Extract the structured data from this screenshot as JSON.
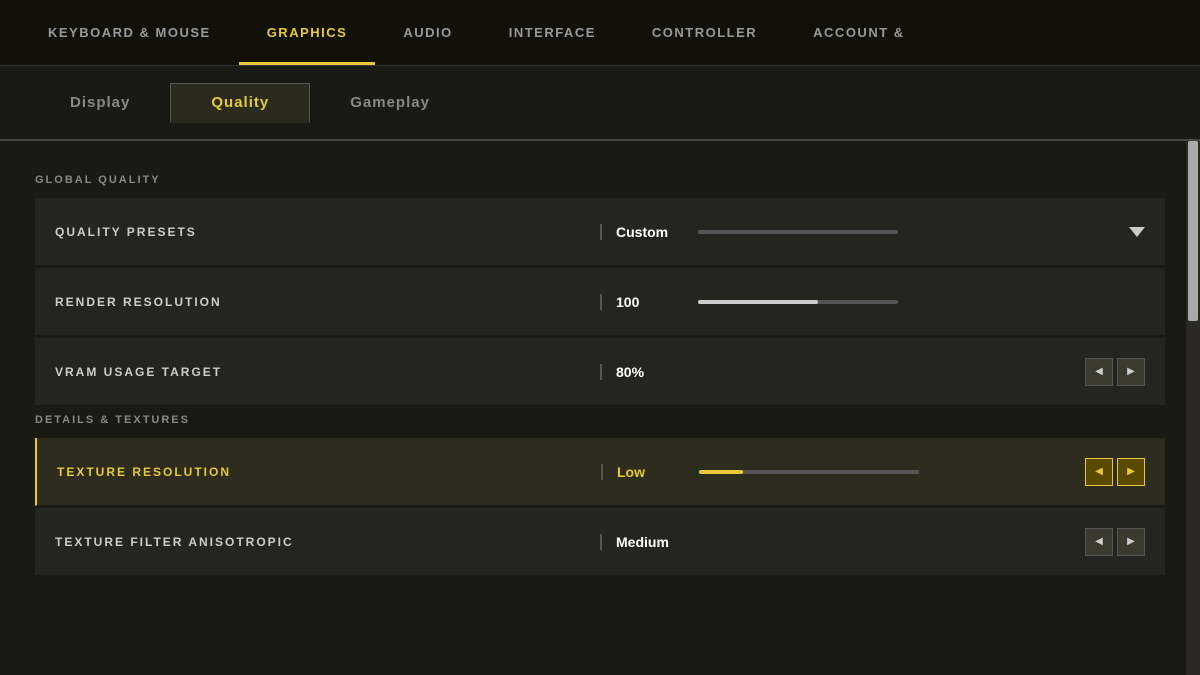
{
  "topNav": {
    "items": [
      {
        "id": "keyboard-mouse",
        "label": "KEYBOARD & MOUSE",
        "active": false
      },
      {
        "id": "graphics",
        "label": "GRAPHICS",
        "active": true
      },
      {
        "id": "audio",
        "label": "AUDIO",
        "active": false
      },
      {
        "id": "interface",
        "label": "INTERFACE",
        "active": false
      },
      {
        "id": "controller",
        "label": "CONTROLLER",
        "active": false
      },
      {
        "id": "account",
        "label": "ACCOUNT &",
        "active": false
      }
    ]
  },
  "subTabs": {
    "items": [
      {
        "id": "display",
        "label": "Display",
        "active": false
      },
      {
        "id": "quality",
        "label": "Quality",
        "active": true
      },
      {
        "id": "gameplay",
        "label": "Gameplay",
        "active": false
      }
    ]
  },
  "sections": [
    {
      "id": "global-quality",
      "header": "GLOBAL QUALITY",
      "rows": [
        {
          "id": "quality-presets",
          "label": "QUALITY PRESETS",
          "value": "Custom",
          "controlType": "dropdown",
          "highlighted": false
        },
        {
          "id": "render-resolution",
          "label": "RENDER RESOLUTION",
          "value": "100",
          "controlType": "slider",
          "sliderFill": 60,
          "sliderColor": "white",
          "highlighted": false
        },
        {
          "id": "vram-usage-target",
          "label": "VRAM USAGE TARGET",
          "value": "80%",
          "controlType": "arrows",
          "highlighted": false
        }
      ]
    },
    {
      "id": "details-textures",
      "header": "DETAILS & TEXTURES",
      "rows": [
        {
          "id": "texture-resolution",
          "label": "TEXTURE RESOLUTION",
          "value": "Low",
          "controlType": "arrows",
          "sliderFill": 20,
          "sliderColor": "yellow",
          "highlighted": true
        },
        {
          "id": "texture-filter-anisotropic",
          "label": "TEXTURE FILTER ANISOTROPIC",
          "value": "Medium",
          "controlType": "arrows",
          "highlighted": false
        }
      ]
    }
  ]
}
